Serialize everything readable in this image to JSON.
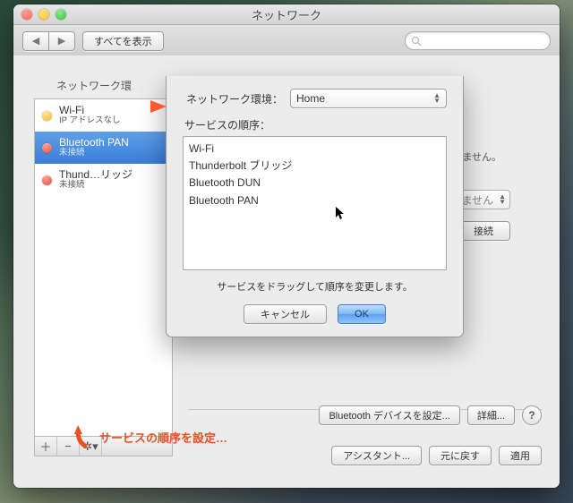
{
  "window": {
    "title": "ネットワーク"
  },
  "toolbar": {
    "back_glyph": "◀",
    "forward_glyph": "▶",
    "show_all": "すべてを表示"
  },
  "panel": {
    "partial_label": "ネットワーク環"
  },
  "sidebar": {
    "items": [
      {
        "name": "Wi-Fi",
        "sub": "IP アドレスなし",
        "status": "yellow"
      },
      {
        "name": "Bluetooth PAN",
        "sub": "未接続",
        "status": "red",
        "selected": true
      },
      {
        "name": "Thund…リッジ",
        "sub": "未接続",
        "status": "red"
      }
    ],
    "footer": {
      "add": "＋",
      "remove": "−",
      "gear": "✲▾"
    }
  },
  "right": {
    "note_suffix": "いません。",
    "dim_select_suffix": "ません",
    "connect": "接続",
    "bluetooth_setup": "Bluetooth デバイスを設定...",
    "advanced": "詳細...",
    "help": "?"
  },
  "footer": {
    "assistant": "アシスタント...",
    "revert": "元に戻す",
    "apply": "適用"
  },
  "sheet": {
    "location_label": "ネットワーク環境：",
    "location_value": "Home",
    "order_label": "サービスの順序：",
    "services": [
      "Wi-Fi",
      "Thunderbolt ブリッジ",
      "Bluetooth DUN",
      "Bluetooth PAN"
    ],
    "hint": "サービスをドラッグして順序を変更します。",
    "cancel": "キャンセル",
    "ok": "OK"
  },
  "annotation": {
    "text": "サービスの順序を設定…"
  }
}
